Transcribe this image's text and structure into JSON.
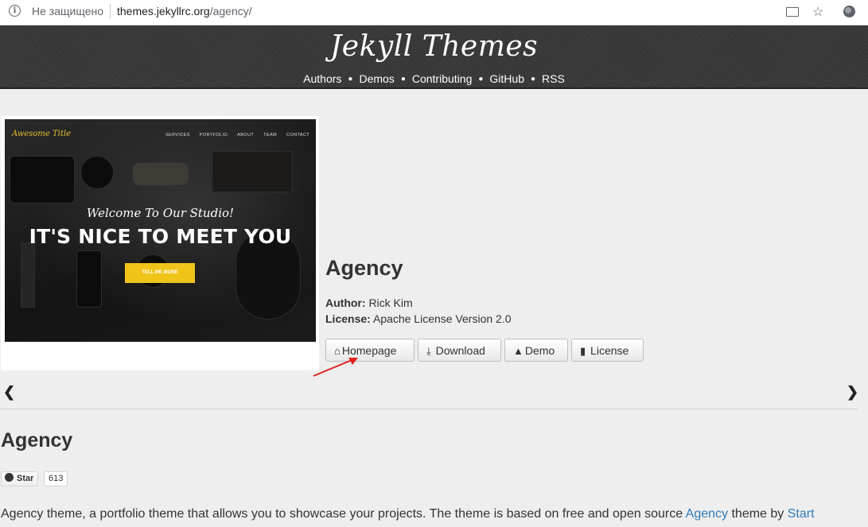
{
  "browser": {
    "security_text": "Не защищено",
    "url_host": "themes.jekyllrc.org",
    "url_path": "/agency/"
  },
  "site": {
    "brand": "Jekyll Themes",
    "nav": [
      "Authors",
      "Demos",
      "Contributing",
      "GitHub",
      "RSS"
    ]
  },
  "preview": {
    "site_title": "Awesome Title",
    "menu": [
      "SERVICES",
      "PORTFOLIO",
      "ABOUT",
      "TEAM",
      "CONTACT"
    ],
    "welcome": "Welcome To Our Studio!",
    "headline": "IT'S NICE TO MEET YOU",
    "cta": "TELL ME MORE"
  },
  "theme": {
    "title": "Agency",
    "author_label": "Author:",
    "author": "Rick Kim",
    "license_label": "License:",
    "license": "Apache License Version 2.0"
  },
  "buttons": {
    "homepage": "Homepage",
    "download": "Download",
    "demo": "Demo",
    "license": "License"
  },
  "section": {
    "title": "Agency",
    "star_label": "Star",
    "star_count": "613",
    "desc_prefix": "Agency theme, a portfolio theme that allows you to showcase your projects. The theme is based on free and open source ",
    "desc_link1": "Agency",
    "desc_middle": " theme by ",
    "desc_link2": "Start"
  },
  "icons": {
    "info": "info-icon",
    "cast": "cast-icon",
    "star": "star-icon",
    "globe": "translate-icon",
    "prev": "chevron-left-icon",
    "next": "chevron-right-icon"
  },
  "colors": {
    "header_bg": "#3a3a3a",
    "link": "#337ab7",
    "cta": "#f0c419",
    "annotation_arrow": "#e02020"
  }
}
